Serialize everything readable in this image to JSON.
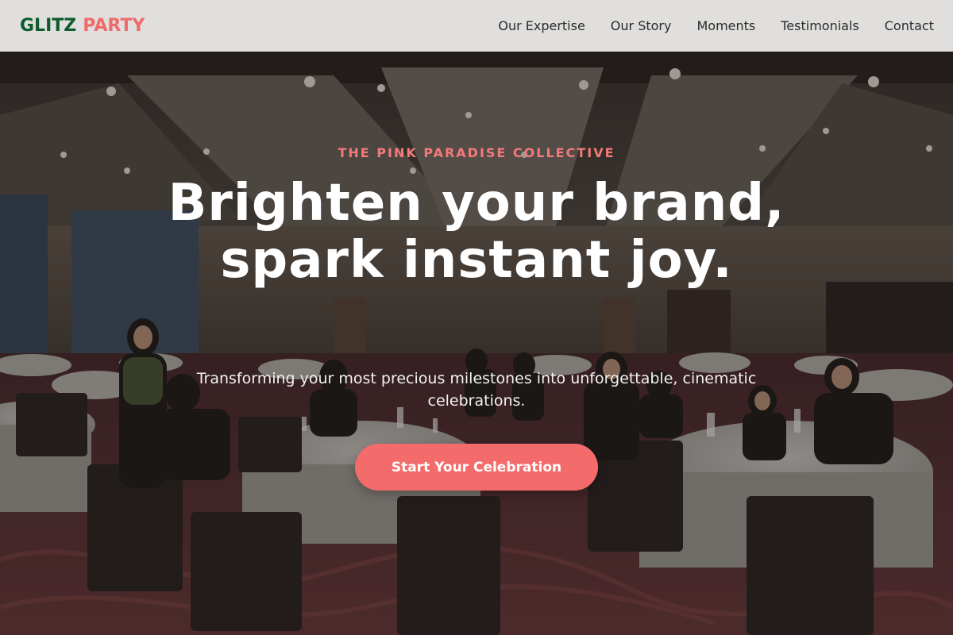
{
  "brand": {
    "word1": "GLITZ",
    "word2": "PARTY"
  },
  "nav": {
    "items": [
      "Our Expertise",
      "Our Story",
      "Moments",
      "Testimonials",
      "Contact"
    ]
  },
  "hero": {
    "eyebrow": "THE PINK PARADISE COLLECTIVE",
    "headline": "Brighten your brand, spark instant joy.",
    "subheadline": "Transforming your most precious milestones into unforgettable, cinematic celebrations.",
    "cta_label": "Start Your Celebration"
  },
  "colors": {
    "brand_green": "#0d5a2c",
    "brand_pink": "#f06a6a",
    "cta_background": "#f46b6b",
    "header_background": "#e0dfdd"
  }
}
